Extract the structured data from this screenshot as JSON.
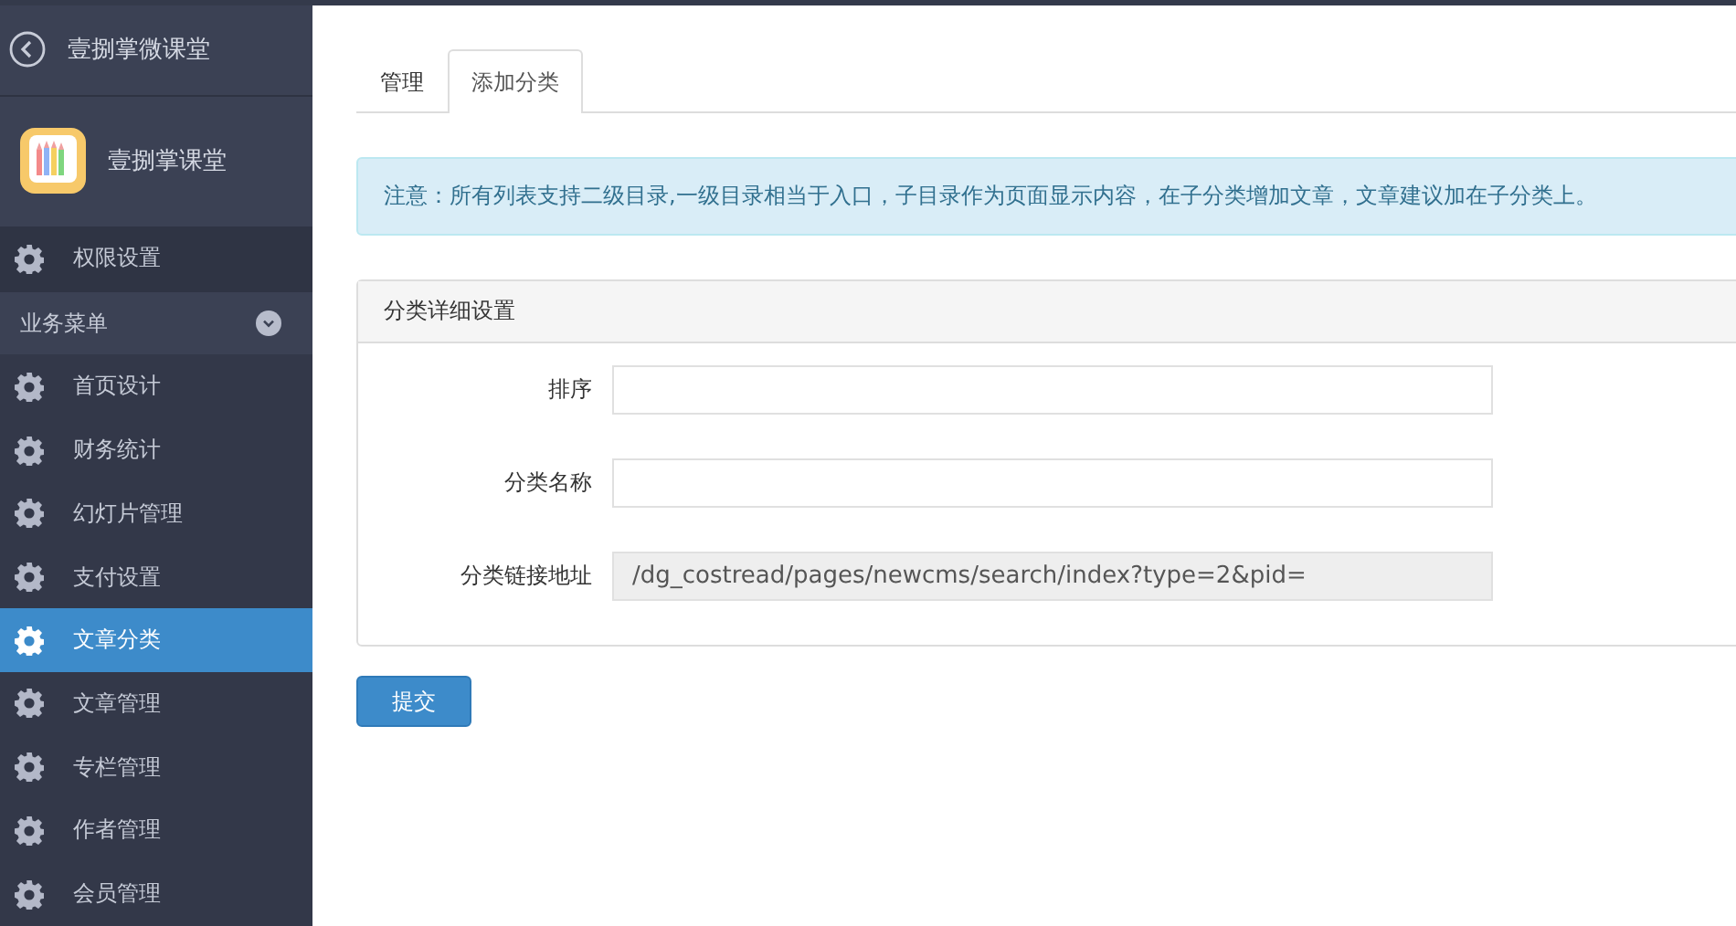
{
  "sidebar": {
    "back_title": "壹捌掌微课堂",
    "app_name": "壹捌掌课堂",
    "top_items": [
      {
        "label": "权限设置",
        "selected": false
      }
    ],
    "group": {
      "label": "业务菜单",
      "expanded": true,
      "items": [
        {
          "label": "首页设计",
          "selected": false
        },
        {
          "label": "财务统计",
          "selected": false
        },
        {
          "label": "幻灯片管理",
          "selected": false
        },
        {
          "label": "支付设置",
          "selected": false
        },
        {
          "label": "文章分类",
          "selected": true
        },
        {
          "label": "文章管理",
          "selected": false
        },
        {
          "label": "专栏管理",
          "selected": false
        },
        {
          "label": "作者管理",
          "selected": false
        },
        {
          "label": "会员管理",
          "selected": false
        }
      ]
    }
  },
  "tabs": [
    {
      "label": "管理",
      "selected": false
    },
    {
      "label": "添加分类",
      "selected": true
    }
  ],
  "notice": "注意：所有列表支持二级目录,一级目录相当于入口，子目录作为页面显示内容，在子分类增加文章，文章建议加在子分类上。",
  "panel": {
    "title": "分类详细设置",
    "fields": [
      {
        "label": "排序",
        "disabled": false
      },
      {
        "label": "分类名称",
        "disabled": false
      },
      {
        "label": "分类链接地址",
        "value": "/dg_costread/pages/newcms/search/index?type=2&pid=",
        "disabled": true
      }
    ]
  },
  "submit": "提交"
}
